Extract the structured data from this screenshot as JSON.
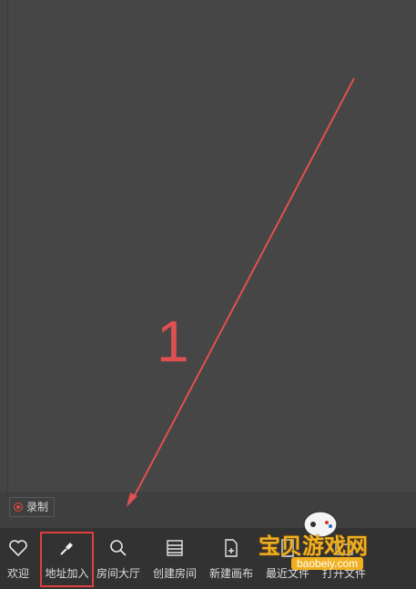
{
  "record_button": {
    "label": "录制"
  },
  "toolbar": {
    "items": [
      {
        "label": "欢迎",
        "icon": "heart-icon"
      },
      {
        "label": "地址加入",
        "icon": "link-icon",
        "highlighted": true
      },
      {
        "label": "房间大厅",
        "icon": "search-icon"
      },
      {
        "label": "创建房间",
        "icon": "list-icon"
      },
      {
        "label": "新建画布",
        "icon": "new-file-icon"
      },
      {
        "label": "最近文件",
        "icon": "recent-files-icon"
      },
      {
        "label": "打开文件",
        "icon": "open-file-icon"
      }
    ]
  },
  "annotation": {
    "step": "1",
    "color": "#e05050"
  },
  "watermark": {
    "text": "宝贝游戏网",
    "url": "baobeiy.com"
  }
}
